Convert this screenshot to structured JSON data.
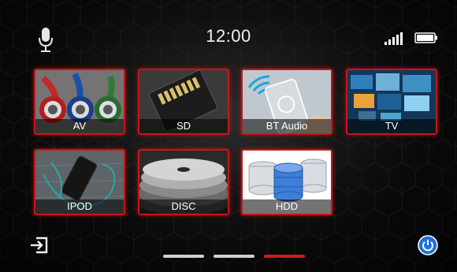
{
  "status": {
    "time": "12:00",
    "icons": [
      "microphone-icon",
      "signal-strength-icon",
      "battery-icon"
    ]
  },
  "tiles": [
    {
      "label": "AV",
      "icon": "rca-cables-image"
    },
    {
      "label": "SD",
      "icon": "sd-card-image"
    },
    {
      "label": "BT Audio",
      "icon": "bluetooth-phone-image"
    },
    {
      "label": "TV",
      "icon": "tv-screens-image"
    },
    {
      "label": "IPOD",
      "icon": "smartphone-earphones-image"
    },
    {
      "label": "DISC",
      "icon": "discs-image"
    },
    {
      "label": "HDD",
      "icon": "database-drives-image"
    }
  ],
  "footer": {
    "left_icon": "exit-icon",
    "right_icon": "power-icon"
  },
  "pagination": {
    "pages": 3,
    "active_page": 3
  },
  "colors": {
    "accent": "#d01a20",
    "background": "#111111",
    "text": "#f2f2f2",
    "power_button": "#1e6fd9"
  }
}
